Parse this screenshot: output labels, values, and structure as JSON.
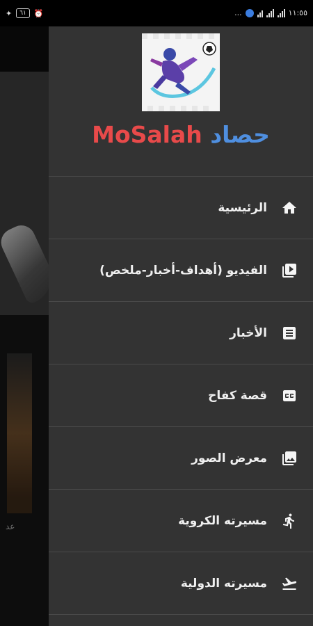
{
  "status_bar": {
    "time": "١١:٥٥",
    "battery": "٦١",
    "more": "..."
  },
  "background": {
    "card_text": "عد"
  },
  "drawer": {
    "title_ar": "حصاد",
    "title_en": "MoSalah",
    "menu": [
      {
        "label": "الرئيسية",
        "icon": "home-icon"
      },
      {
        "label": "الفيديو (أهداف-أخبار-ملخص)",
        "icon": "video-library-icon"
      },
      {
        "label": "الأخبار",
        "icon": "news-icon"
      },
      {
        "label": "قصة كفاح",
        "icon": "closed-caption-icon"
      },
      {
        "label": "معرض الصور",
        "icon": "photo-gallery-icon"
      },
      {
        "label": "مسيرته الكروية",
        "icon": "running-icon"
      },
      {
        "label": "مسيرته الدولية",
        "icon": "flight-takeoff-icon"
      }
    ]
  },
  "colors": {
    "drawer_bg": "#333333",
    "title_ar": "#4f8fe0",
    "title_en": "#e84a4a"
  }
}
